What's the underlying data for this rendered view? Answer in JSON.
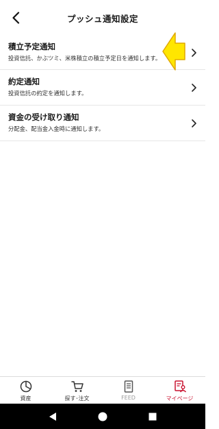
{
  "header": {
    "title": "プッシュ通知設定",
    "back_icon": "back-arrow-icon"
  },
  "settings": [
    {
      "title": "積立予定通知",
      "description": "投資信託、かぶツミ、米株積立の積立予定日を通知します。"
    },
    {
      "title": "約定通知",
      "description": "投資信託の約定を通知します。"
    },
    {
      "title": "資金の受け取り通知",
      "description": "分配金、配当金入金時に通知します。"
    }
  ],
  "tabs": [
    {
      "label": "資産",
      "icon": "asset-pie-icon",
      "state": "normal"
    },
    {
      "label": "探す･注文",
      "icon": "cart-icon",
      "state": "normal"
    },
    {
      "label": "FEED",
      "icon": "feed-document-icon",
      "state": "inactive"
    },
    {
      "label": "マイページ",
      "icon": "mypage-icon",
      "state": "active"
    }
  ],
  "colors": {
    "accent": "#c8102e",
    "pointer_fill": "#ffe600",
    "pointer_stroke": "#e0a800"
  }
}
